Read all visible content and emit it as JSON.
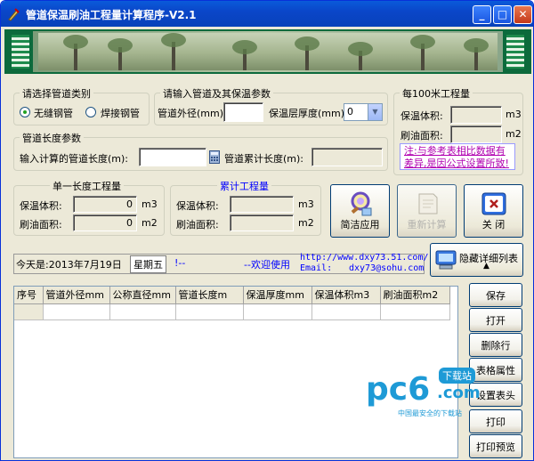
{
  "window": {
    "title": "管道保温刷油工程量计算程序-V2.1",
    "min_label": "_",
    "max_label": "□",
    "close_label": "✕"
  },
  "pipe_type": {
    "legend": "请选择管道类别",
    "option1": "无缝钢管",
    "option2": "焊接钢管",
    "selected": "无缝钢管"
  },
  "params": {
    "legend": "请输入管道及其保温参数",
    "outer_dia_label": "管道外径(mm)",
    "outer_dia_value": "",
    "thickness_label": "保温层厚度(mm)",
    "thickness_value": "0"
  },
  "per100": {
    "legend": "每100米工程量",
    "vol_label": "保温体积:",
    "vol_value": "",
    "vol_unit": "m3",
    "area_label": "刷油面积:",
    "area_value": "",
    "area_unit": "m2"
  },
  "length": {
    "legend": "管道长度参数",
    "input_label": "输入计算的管道长度(m):",
    "input_value": "",
    "cum_label": "管道累计长度(m):",
    "cum_value": ""
  },
  "note": "注:与参考表相比数据有差异,是因公式设置所致!",
  "single": {
    "legend": "单一长度工程量",
    "vol_label": "保温体积:",
    "vol_value": "0",
    "vol_unit": "m3",
    "area_label": "刷油面积:",
    "area_value": "0",
    "area_unit": "m2"
  },
  "cumulative": {
    "legend": "累计工程量",
    "vol_label": "保温体积:",
    "vol_value": "",
    "vol_unit": "m3",
    "area_label": "刷油面积:",
    "area_value": "",
    "area_unit": "m2"
  },
  "buttons": {
    "apply": "简洁应用",
    "recalc": "重新计算",
    "close": "关 闭",
    "hide_detail": "隐藏详细列表"
  },
  "status": {
    "today": "今天是:2013年7月19日",
    "weekday": "星期五",
    "sep": "!--",
    "welcome": "--欢迎使用",
    "url": "http://www.dxy73.51.com/",
    "email_label": "Email:",
    "email": "dxy73@sohu.com"
  },
  "table": {
    "columns": [
      "序号",
      "管道外径mm",
      "公称直径mm",
      "管道长度m",
      "保温厚度mm",
      "保温体积m3",
      "刷油面积m2"
    ]
  },
  "side_buttons": [
    "保存",
    "打开",
    "删除行",
    "表格属性",
    "设置表头",
    "打印",
    "打印预览"
  ],
  "watermark": {
    "brand": "pc6",
    "tag": "下载站",
    "domain": ".com",
    "slogan": "中国最安全的下载站"
  },
  "colors": {
    "title_blue": "#0a50d0",
    "accent_blue": "#0000ff",
    "note_magenta": "#b000b0",
    "banner_green": "#0c6a3c"
  }
}
